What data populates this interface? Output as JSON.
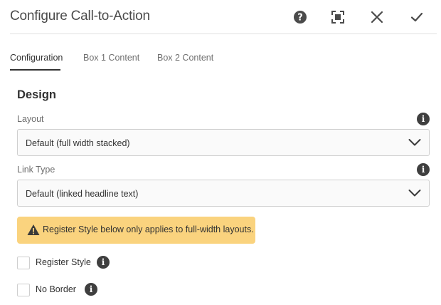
{
  "dialog": {
    "title": "Configure Call-to-Action"
  },
  "header_actions": {
    "help_icon": "help-icon",
    "fullscreen_icon": "fullscreen-icon",
    "close_icon": "close-icon",
    "done_icon": "checkmark-icon"
  },
  "tabs": [
    {
      "label": "Configuration",
      "active": true
    },
    {
      "label": "Box 1 Content",
      "active": false
    },
    {
      "label": "Box 2 Content",
      "active": false
    }
  ],
  "design": {
    "heading": "Design",
    "layout": {
      "label": "Layout",
      "value": "Default (full width stacked)"
    },
    "link_type": {
      "label": "Link Type",
      "value": "Default (linked headline text)"
    },
    "alert": {
      "text": "Register Style below only applies to full-width layouts.",
      "color": "#fad37e"
    },
    "register_style": {
      "label": "Register Style",
      "checked": false
    },
    "no_border": {
      "label": "No Border",
      "checked": false
    }
  }
}
